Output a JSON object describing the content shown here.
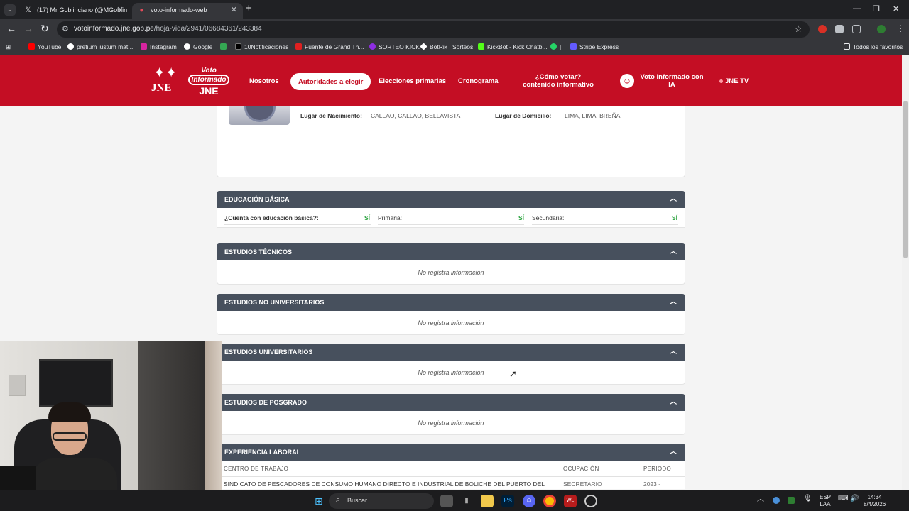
{
  "browser": {
    "tabs": [
      {
        "title": "(17) Mr Goblinciano (@MGoblin"
      },
      {
        "title": "voto-informado-web"
      }
    ],
    "new_tab": "+",
    "url_host": "votoinformado.jne.gob.pe",
    "url_path": "/hoja-vida/2941/06684361/243384",
    "bookmarks": [
      {
        "label": "YouTube",
        "color": "#ff0000"
      },
      {
        "label": "pretium iustum mat...",
        "color": "#ffffff"
      },
      {
        "label": "Instagram",
        "color": "#d6249f"
      },
      {
        "label": "Google",
        "color": "#ffffff"
      },
      {
        "label": "",
        "color": "#34a853"
      },
      {
        "label": "10Notificaciones",
        "color": "#000000"
      },
      {
        "label": "Fuente de Grand Th...",
        "color": "#e02020"
      },
      {
        "label": "SORTEO KICK",
        "color": "#8e2de2"
      },
      {
        "label": "BotRix | Sorteos",
        "color": "#ffffff"
      },
      {
        "label": "KickBot - Kick Chatb...",
        "color": "#53fc18"
      },
      {
        "label": "|",
        "color": "#25d366"
      },
      {
        "label": "Stripe Express",
        "color": "#635bff"
      }
    ],
    "all_bookmarks": "Todos los favoritos"
  },
  "site": {
    "brand_color": "#c40e24",
    "logo_jne": "JNE",
    "logo_voto": "Voto",
    "logo_informado": "Informado",
    "logo_jne2": "JNE",
    "nav": [
      "Nosotros",
      "Autoridades a elegir",
      "Elecciones primarias",
      "Cronograma",
      "¿Cómo votar? contenido informativo",
      "Voto informado con IA",
      "JNE TV"
    ]
  },
  "profile": {
    "birth_label": "Lugar de Nacimiento:",
    "birth_value": "CALLAO, CALLAO, BELLAVISTA",
    "home_label": "Lugar de Domicilio:",
    "home_value": "LIMA, LIMA, BREÑA"
  },
  "sections": {
    "basic": {
      "title": "EDUCACIÓN BÁSICA",
      "q": "¿Cuenta con educación básica?:",
      "q_val": "SÍ",
      "primaria": "Primaria:",
      "primaria_val": "SÍ",
      "secundaria": "Secundaria:",
      "secundaria_val": "SÍ"
    },
    "tecnicos": {
      "title": "ESTUDIOS TÉCNICOS",
      "empty": "No registra información"
    },
    "no_univ": {
      "title": "ESTUDIOS NO UNIVERSITARIOS",
      "empty": "No registra información"
    },
    "univ": {
      "title": "ESTUDIOS UNIVERSITARIOS",
      "empty": "No registra información"
    },
    "posgrado": {
      "title": "ESTUDIOS DE POSGRADO",
      "empty": "No registra información"
    },
    "experiencia": {
      "title": "EXPERIENCIA LABORAL",
      "columns": [
        "CENTRO DE TRABAJO",
        "OCUPACIÓN",
        "PERIODO"
      ],
      "rows": [
        {
          "centro": "SINDICATO DE PESCADORES DE CONSUMO HUMANO DIRECTO E INDUSTRIAL DE BOLICHE DEL PUERTO DEL",
          "ocupacion": "SECRETARIO",
          "periodo": "2023 -"
        }
      ]
    }
  },
  "taskbar": {
    "search": "Buscar",
    "lang1": "ESP",
    "lang2": "LAA",
    "time": "14:34",
    "date": "8/4/2026"
  }
}
